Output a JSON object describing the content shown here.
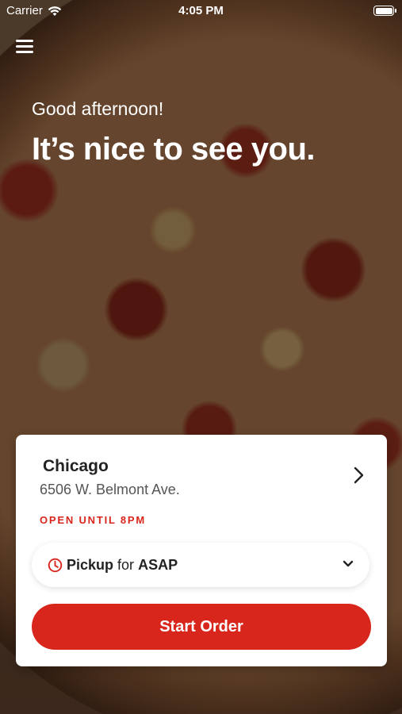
{
  "status_bar": {
    "carrier": "Carrier",
    "time": "4:05 PM"
  },
  "greeting": "Good afternoon!",
  "headline": "It’s nice to see you.",
  "location": {
    "name": "Chicago",
    "address": "6506 W. Belmont Ave.",
    "hours": "OPEN UNTIL 8PM"
  },
  "order_mode": {
    "mode": "Pickup",
    "connector": "for",
    "time": "ASAP"
  },
  "start_order_label": "Start Order",
  "icons": {
    "menu": "hamburger-menu-icon",
    "location_chevron": "chevron-right-icon",
    "clock": "clock-icon",
    "dropdown": "chevron-down-icon"
  },
  "colors": {
    "accent": "#d9261c",
    "card_bg": "#ffffff"
  }
}
